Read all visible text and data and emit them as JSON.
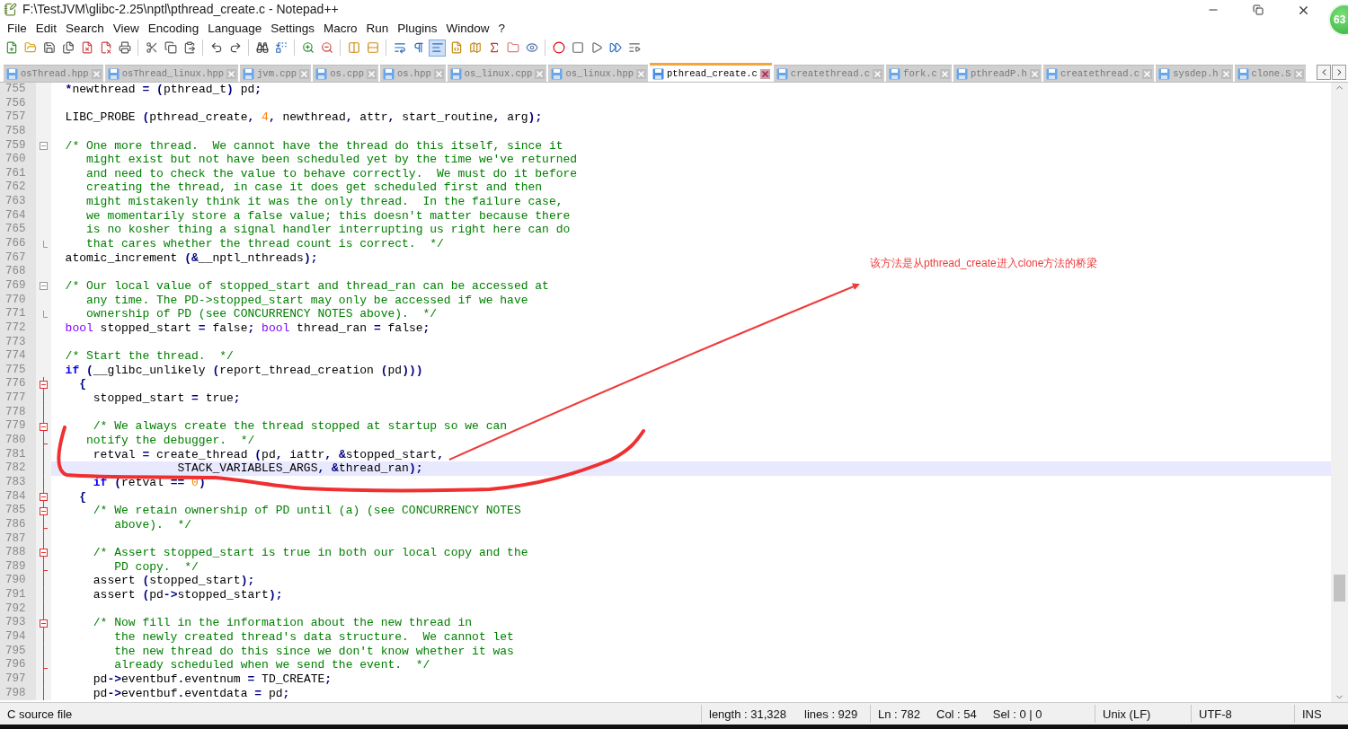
{
  "window": {
    "title": "F:\\TestJVM\\glibc-2.25\\nptl\\pthread_create.c - Notepad++",
    "badge": "63"
  },
  "menu": [
    "File",
    "Edit",
    "Search",
    "View",
    "Encoding",
    "Language",
    "Settings",
    "Macro",
    "Run",
    "Plugins",
    "Window",
    "?"
  ],
  "toolbar": [
    {
      "kind": "new",
      "pressed": false
    },
    {
      "kind": "open",
      "pressed": false
    },
    {
      "kind": "save",
      "pressed": false
    },
    {
      "kind": "save-all",
      "pressed": false
    },
    {
      "kind": "close",
      "pressed": false
    },
    {
      "kind": "close-all",
      "pressed": false
    },
    {
      "kind": "print",
      "pressed": false
    },
    {
      "kind": "sep"
    },
    {
      "kind": "cut",
      "pressed": false
    },
    {
      "kind": "copy",
      "pressed": false
    },
    {
      "kind": "paste",
      "pressed": false
    },
    {
      "kind": "sep"
    },
    {
      "kind": "undo",
      "pressed": false
    },
    {
      "kind": "redo",
      "pressed": false
    },
    {
      "kind": "sep"
    },
    {
      "kind": "find",
      "pressed": false
    },
    {
      "kind": "replace",
      "pressed": false
    },
    {
      "kind": "sep"
    },
    {
      "kind": "zoom-in",
      "pressed": false
    },
    {
      "kind": "zoom-out",
      "pressed": false
    },
    {
      "kind": "sep"
    },
    {
      "kind": "sync-v",
      "pressed": false
    },
    {
      "kind": "sync-h",
      "pressed": false
    },
    {
      "kind": "sep"
    },
    {
      "kind": "wrap",
      "pressed": false
    },
    {
      "kind": "all-chars",
      "pressed": false
    },
    {
      "kind": "indent-guide",
      "pressed": true
    },
    {
      "kind": "lang",
      "pressed": false
    },
    {
      "kind": "map",
      "pressed": false
    },
    {
      "kind": "function",
      "pressed": false
    },
    {
      "kind": "folder",
      "pressed": false
    },
    {
      "kind": "monitor",
      "pressed": false
    },
    {
      "kind": "sep"
    },
    {
      "kind": "record",
      "pressed": false
    },
    {
      "kind": "stop",
      "pressed": false
    },
    {
      "kind": "play",
      "pressed": false
    },
    {
      "kind": "play-multi",
      "pressed": false
    },
    {
      "kind": "save-macro",
      "pressed": false
    }
  ],
  "tabs": [
    {
      "label": "osThread.hpp",
      "selected": false
    },
    {
      "label": "osThread_linux.hpp",
      "selected": false
    },
    {
      "label": "jvm.cpp",
      "selected": false
    },
    {
      "label": "os.cpp",
      "selected": false
    },
    {
      "label": "os.hpp",
      "selected": false
    },
    {
      "label": "os_linux.cpp",
      "selected": false
    },
    {
      "label": "os_linux.hpp",
      "selected": false
    },
    {
      "label": "pthread_create.c",
      "selected": true
    },
    {
      "label": "createthread.c",
      "selected": false
    },
    {
      "label": "fork.c",
      "selected": false
    },
    {
      "label": "pthreadP.h",
      "selected": false
    },
    {
      "label": "createthread.c",
      "selected": false
    },
    {
      "label": "sysdep.h",
      "selected": false
    },
    {
      "label": "clone.S",
      "selected": false
    }
  ],
  "lines": [
    {
      "num": "755",
      "collapsible": false,
      "fold_end": false,
      "in_block": false,
      "highlighted": false,
      "tokens": [
        {
          "kind": "code",
          "text": "  *newthread = (pthread_t) pd;"
        }
      ]
    },
    {
      "num": "756",
      "collapsible": false,
      "fold_end": false,
      "in_block": false,
      "highlighted": false
    },
    {
      "num": "757",
      "collapsible": false,
      "fold_end": false,
      "in_block": false,
      "highlighted": false,
      "tokens": [
        {
          "kind": "code",
          "text": "  LIBC_PROBE (pthread_create, "
        },
        {
          "kind": "number",
          "text": "4"
        },
        {
          "kind": "code",
          "text": ", newthread, attr, start_routine, arg);"
        }
      ]
    },
    {
      "num": "758",
      "collapsible": false,
      "fold_end": false,
      "in_block": false,
      "highlighted": false
    },
    {
      "num": "759",
      "collapsible": true,
      "fold_end": false,
      "in_block": false,
      "highlighted": false,
      "tokens": [
        {
          "kind": "comment",
          "text": "  /* One more thread.  We cannot have the thread do this itself, since it"
        }
      ]
    },
    {
      "num": "760",
      "collapsible": false,
      "fold_end": false,
      "in_block": false,
      "highlighted": false,
      "tokens": [
        {
          "kind": "comment",
          "text": "     might exist but not have been scheduled yet by the time we've returned"
        }
      ]
    },
    {
      "num": "761",
      "collapsible": false,
      "fold_end": false,
      "in_block": false,
      "highlighted": false,
      "tokens": [
        {
          "kind": "comment",
          "text": "     and need to check the value to behave correctly.  We must do it before"
        }
      ]
    },
    {
      "num": "762",
      "collapsible": false,
      "fold_end": false,
      "in_block": false,
      "highlighted": false,
      "tokens": [
        {
          "kind": "comment",
          "text": "     creating the thread, in case it does get scheduled first and then"
        }
      ]
    },
    {
      "num": "763",
      "collapsible": false,
      "fold_end": false,
      "in_block": false,
      "highlighted": false,
      "tokens": [
        {
          "kind": "comment",
          "text": "     might mistakenly think it was the only thread.  In the failure case,"
        }
      ]
    },
    {
      "num": "764",
      "collapsible": false,
      "fold_end": false,
      "in_block": false,
      "highlighted": false,
      "tokens": [
        {
          "kind": "comment",
          "text": "     we momentarily store a false value; this doesn't matter because there"
        }
      ]
    },
    {
      "num": "765",
      "collapsible": false,
      "fold_end": false,
      "in_block": false,
      "highlighted": false,
      "tokens": [
        {
          "kind": "comment",
          "text": "     is no kosher thing a signal handler interrupting us right here can do"
        }
      ]
    },
    {
      "num": "766",
      "collapsible": false,
      "fold_end": true,
      "in_block": false,
      "highlighted": false,
      "tokens": [
        {
          "kind": "comment",
          "text": "     that cares whether the thread count is correct.  */"
        }
      ]
    },
    {
      "num": "767",
      "collapsible": false,
      "fold_end": false,
      "in_block": false,
      "highlighted": false,
      "tokens": [
        {
          "kind": "code",
          "text": "  atomic_increment (&__nptl_nthreads);"
        }
      ]
    },
    {
      "num": "768",
      "collapsible": false,
      "fold_end": false,
      "in_block": false,
      "highlighted": false
    },
    {
      "num": "769",
      "collapsible": true,
      "fold_end": false,
      "in_block": false,
      "highlighted": false,
      "tokens": [
        {
          "kind": "comment",
          "text": "  /* Our local value of stopped_start and thread_ran can be accessed at"
        }
      ]
    },
    {
      "num": "770",
      "collapsible": false,
      "fold_end": false,
      "in_block": false,
      "highlighted": false,
      "tokens": [
        {
          "kind": "comment",
          "text": "     any time. The PD->stopped_start may only be accessed if we have"
        }
      ]
    },
    {
      "num": "771",
      "collapsible": false,
      "fold_end": true,
      "in_block": false,
      "highlighted": false,
      "tokens": [
        {
          "kind": "comment",
          "text": "     ownership of PD (see CONCURRENCY NOTES above).  */"
        }
      ]
    },
    {
      "num": "772",
      "collapsible": false,
      "fold_end": false,
      "in_block": false,
      "highlighted": false,
      "tokens": [
        {
          "kind": "type",
          "text": "  bool"
        },
        {
          "kind": "code",
          "text": " stopped_start = false; "
        },
        {
          "kind": "type",
          "text": "bool"
        },
        {
          "kind": "code",
          "text": " thread_ran = false;"
        }
      ]
    },
    {
      "num": "773",
      "collapsible": false,
      "fold_end": false,
      "in_block": false,
      "highlighted": false
    },
    {
      "num": "774",
      "collapsible": false,
      "fold_end": false,
      "in_block": false,
      "highlighted": false,
      "tokens": [
        {
          "kind": "comment",
          "text": "  /* Start the thread.  */"
        }
      ]
    },
    {
      "num": "775",
      "collapsible": false,
      "fold_end": false,
      "in_block": false,
      "highlighted": false,
      "tokens": [
        {
          "kind": "keyword",
          "text": "  if"
        },
        {
          "kind": "code",
          "text": " (__glibc_unlikely (report_thread_creation (pd)))"
        }
      ]
    },
    {
      "num": "776",
      "collapsible": true,
      "fold_end": false,
      "in_block": true,
      "highlighted": false,
      "tokens": [
        {
          "kind": "code",
          "text": "    {"
        }
      ]
    },
    {
      "num": "777",
      "collapsible": false,
      "fold_end": false,
      "in_block": true,
      "highlighted": false,
      "tokens": [
        {
          "kind": "code",
          "text": "      stopped_start = true;"
        }
      ]
    },
    {
      "num": "778",
      "collapsible": false,
      "fold_end": false,
      "in_block": true,
      "highlighted": false
    },
    {
      "num": "779",
      "collapsible": true,
      "fold_end": false,
      "in_block": true,
      "highlighted": false,
      "tokens": [
        {
          "kind": "comment",
          "text": "      /* We always create the thread stopped at startup so we can"
        }
      ]
    },
    {
      "num": "780",
      "collapsible": false,
      "fold_end": true,
      "in_block": true,
      "highlighted": false,
      "tokens": [
        {
          "kind": "comment",
          "text": "     notify the debugger.  */"
        }
      ]
    },
    {
      "num": "781",
      "collapsible": false,
      "fold_end": false,
      "in_block": true,
      "highlighted": false,
      "tokens": [
        {
          "kind": "code",
          "text": "      retval = create_thread (pd, iattr, &stopped_start,"
        }
      ]
    },
    {
      "num": "782",
      "collapsible": false,
      "fold_end": false,
      "in_block": true,
      "highlighted": true,
      "tokens": [
        {
          "kind": "code",
          "text": "                  STACK_VARIABLES_ARGS, &thread_ran);"
        }
      ]
    },
    {
      "num": "783",
      "collapsible": false,
      "fold_end": false,
      "in_block": true,
      "highlighted": false,
      "tokens": [
        {
          "kind": "keyword",
          "text": "      if"
        },
        {
          "kind": "code",
          "text": " (retval == "
        },
        {
          "kind": "number",
          "text": "0"
        },
        {
          "kind": "code",
          "text": ")"
        }
      ]
    },
    {
      "num": "784",
      "collapsible": true,
      "fold_end": false,
      "in_block": true,
      "highlighted": false,
      "tokens": [
        {
          "kind": "code",
          "text": "    {"
        }
      ]
    },
    {
      "num": "785",
      "collapsible": true,
      "fold_end": false,
      "in_block": true,
      "highlighted": false,
      "tokens": [
        {
          "kind": "comment",
          "text": "      /* We retain ownership of PD until (a) (see CONCURRENCY NOTES"
        }
      ]
    },
    {
      "num": "786",
      "collapsible": false,
      "fold_end": true,
      "in_block": true,
      "highlighted": false,
      "tokens": [
        {
          "kind": "comment",
          "text": "         above).  */"
        }
      ]
    },
    {
      "num": "787",
      "collapsible": false,
      "fold_end": false,
      "in_block": true,
      "highlighted": false
    },
    {
      "num": "788",
      "collapsible": true,
      "fold_end": false,
      "in_block": true,
      "highlighted": false,
      "tokens": [
        {
          "kind": "comment",
          "text": "      /* Assert stopped_start is true in both our local copy and the"
        }
      ]
    },
    {
      "num": "789",
      "collapsible": false,
      "fold_end": true,
      "in_block": true,
      "highlighted": false,
      "tokens": [
        {
          "kind": "comment",
          "text": "         PD copy.  */"
        }
      ]
    },
    {
      "num": "790",
      "collapsible": false,
      "fold_end": false,
      "in_block": true,
      "highlighted": false,
      "tokens": [
        {
          "kind": "code",
          "text": "      assert (stopped_start);"
        }
      ]
    },
    {
      "num": "791",
      "collapsible": false,
      "fold_end": false,
      "in_block": true,
      "highlighted": false,
      "tokens": [
        {
          "kind": "code",
          "text": "      assert (pd->stopped_start);"
        }
      ]
    },
    {
      "num": "792",
      "collapsible": false,
      "fold_end": false,
      "in_block": true,
      "highlighted": false
    },
    {
      "num": "793",
      "collapsible": true,
      "fold_end": false,
      "in_block": true,
      "highlighted": false,
      "tokens": [
        {
          "kind": "comment",
          "text": "      /* Now fill in the information about the new thread in"
        }
      ]
    },
    {
      "num": "794",
      "collapsible": false,
      "fold_end": false,
      "in_block": true,
      "highlighted": false,
      "tokens": [
        {
          "kind": "comment",
          "text": "         the newly created thread's data structure.  We cannot let"
        }
      ]
    },
    {
      "num": "795",
      "collapsible": false,
      "fold_end": false,
      "in_block": true,
      "highlighted": false,
      "tokens": [
        {
          "kind": "comment",
          "text": "         the new thread do this since we don't know whether it was"
        }
      ]
    },
    {
      "num": "796",
      "collapsible": false,
      "fold_end": true,
      "in_block": true,
      "highlighted": false,
      "tokens": [
        {
          "kind": "comment",
          "text": "         already scheduled when we send the event.  */"
        }
      ]
    },
    {
      "num": "797",
      "collapsible": false,
      "fold_end": false,
      "in_block": true,
      "highlighted": false,
      "tokens": [
        {
          "kind": "code",
          "text": "      pd->eventbuf.eventnum = TD_CREATE;"
        }
      ]
    },
    {
      "num": "798",
      "collapsible": false,
      "fold_end": false,
      "in_block": true,
      "highlighted": false,
      "tokens": [
        {
          "kind": "code",
          "text": "      pd->eventbuf.eventdata = pd;"
        }
      ]
    }
  ],
  "annotation": {
    "text": "该方法是从pthread_create进入clone方法的桥梁"
  },
  "status_bar": {
    "file_type": "C source file",
    "length": "length : 31,328",
    "lines": "lines : 929",
    "ln": "Ln : 782",
    "col": "Col : 54",
    "sel": "Sel : 0 | 0",
    "eol": "Unix (LF)",
    "encoding": "UTF-8",
    "mode": "INS"
  }
}
